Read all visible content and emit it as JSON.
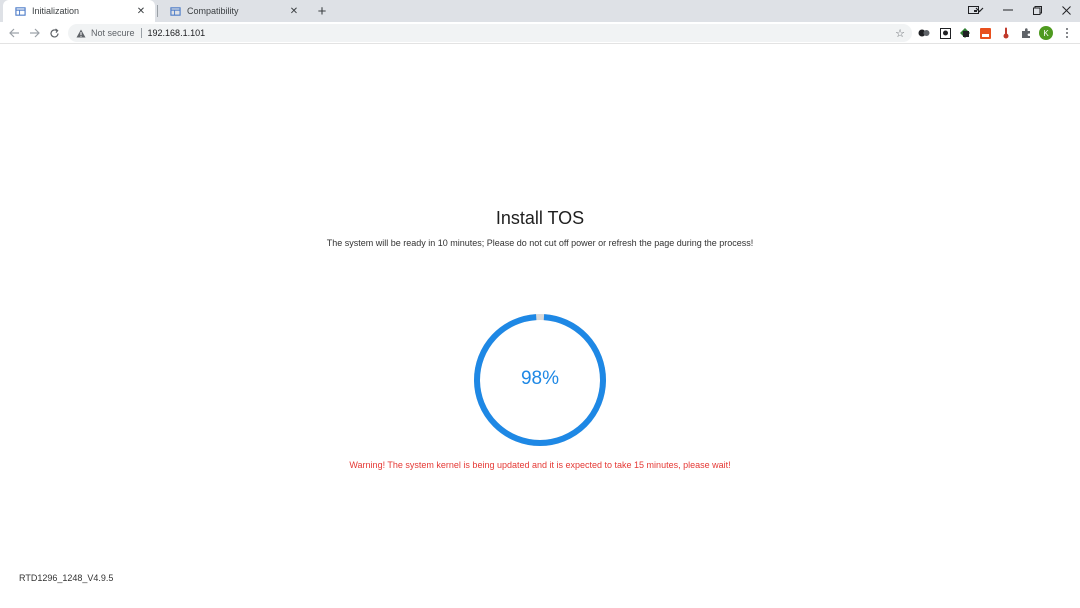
{
  "browser": {
    "tabs": [
      {
        "title": "Initialization",
        "active": true
      },
      {
        "title": "Compatibility",
        "active": false
      }
    ],
    "new_tab_label": "+",
    "address": {
      "security_label": "Not secure",
      "url": "192.168.1.101"
    },
    "profile_initial": "K"
  },
  "page": {
    "title": "Install TOS",
    "subtitle": "The system will be ready in 10 minutes; Please do not cut off power or refresh the page during the process!",
    "progress": {
      "percent": 98,
      "label": "98%",
      "color": "#1e88e5",
      "track_color": "#d9d9d9"
    },
    "warning": "Warning! The system kernel is being updated and it is expected to take 15 minutes, please wait!",
    "warning_color": "#e53935",
    "version": "RTD1296_1248_V4.9.5"
  },
  "icons": {
    "tab_favicon": "window-icon",
    "tab_close": "close-icon",
    "back": "arrow-left-icon",
    "forward": "arrow-right-icon",
    "reload": "reload-icon",
    "security": "warning-triangle-icon",
    "bookmark": "star-icon",
    "extensions": [
      "toggle-ext-icon",
      "photo-ext-icon",
      "scanner-ext-icon",
      "red-ext-icon",
      "thermometer-ext-icon",
      "puzzle-icon"
    ],
    "window_controls": [
      "cast-icon",
      "chevron-down-icon",
      "minimize-icon",
      "restore-icon",
      "window-close-icon"
    ]
  }
}
